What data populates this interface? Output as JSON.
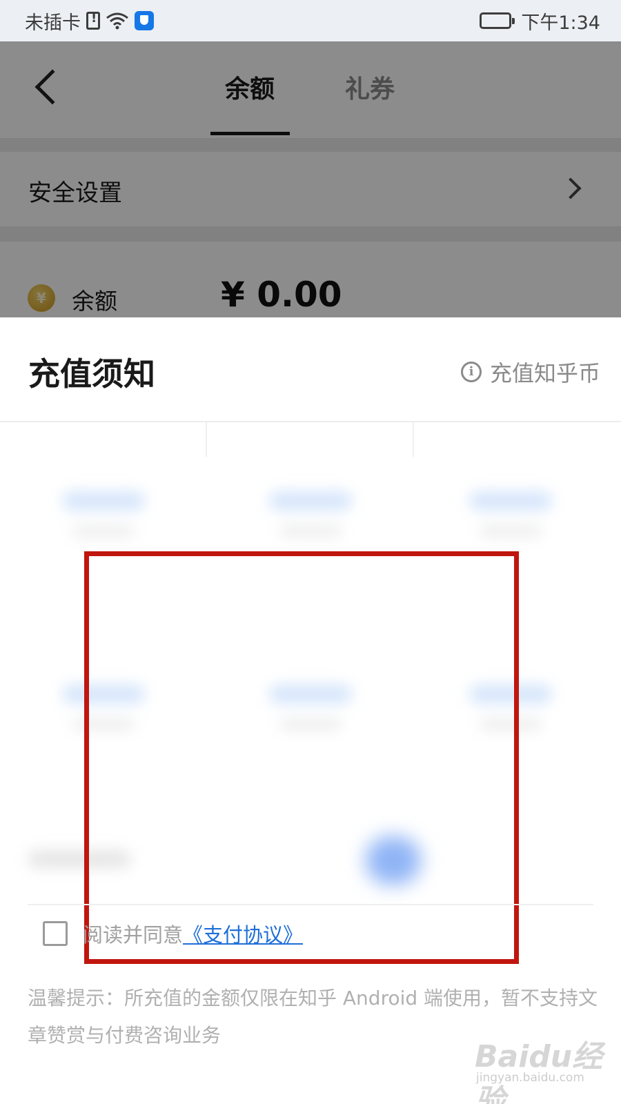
{
  "status_bar": {
    "carrier": "未插卡",
    "time": "下午1:34"
  },
  "background_page": {
    "tabs": [
      {
        "label": "余额",
        "active": true
      },
      {
        "label": "礼券",
        "active": false
      }
    ],
    "security_settings_label": "安全设置",
    "balance_label": "余额",
    "balance_amount": "¥ 0.00",
    "coin_glyph": "¥"
  },
  "sheet": {
    "title": "充值须知",
    "info_link_label": "充值知乎币",
    "info_icon_glyph": "i",
    "agree_prefix": "阅读并同意",
    "agree_link": "《支付协议》",
    "tip": "温馨提示：所充值的金额仅限在知乎 Android 端使用，暂不支持文章赞赏与付费咨询业务"
  },
  "watermark": {
    "text": "Baidu经验",
    "sub": "jingyan.baidu.com"
  },
  "colors": {
    "accent_link": "#1e6fd8",
    "highlight_frame": "#c0160f",
    "overlay": "rgba(0,0,0,0.45)"
  },
  "icons": [
    "sim-alert-icon",
    "wifi-icon",
    "shield-icon",
    "battery-icon",
    "back-arrow-icon",
    "chevron-right-icon",
    "coin-icon",
    "info-icon"
  ]
}
